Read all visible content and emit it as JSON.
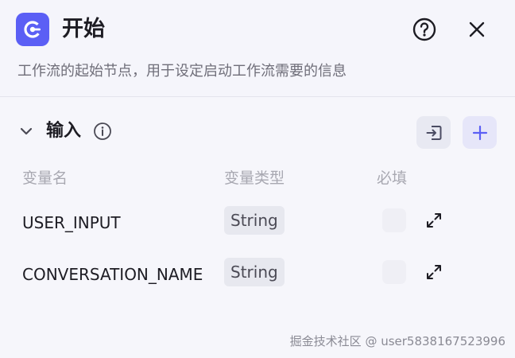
{
  "header": {
    "title": "开始",
    "description": "工作流的起始节点，用于设定启动工作流需要的信息"
  },
  "section": {
    "title": "输入"
  },
  "table": {
    "columns": [
      "变量名",
      "变量类型",
      "必填"
    ],
    "rows": [
      {
        "name": "USER_INPUT",
        "type": "String",
        "required": false
      },
      {
        "name": "CONVERSATION_NAME",
        "type": "String",
        "required": false
      }
    ]
  },
  "watermark": "掘金技术社区 @ user5838167523996",
  "colors": {
    "accent": "#5b5ff5",
    "text_primary": "#1d1c23",
    "text_secondary": "#6f6e79",
    "text_muted": "#a8a8b1"
  }
}
